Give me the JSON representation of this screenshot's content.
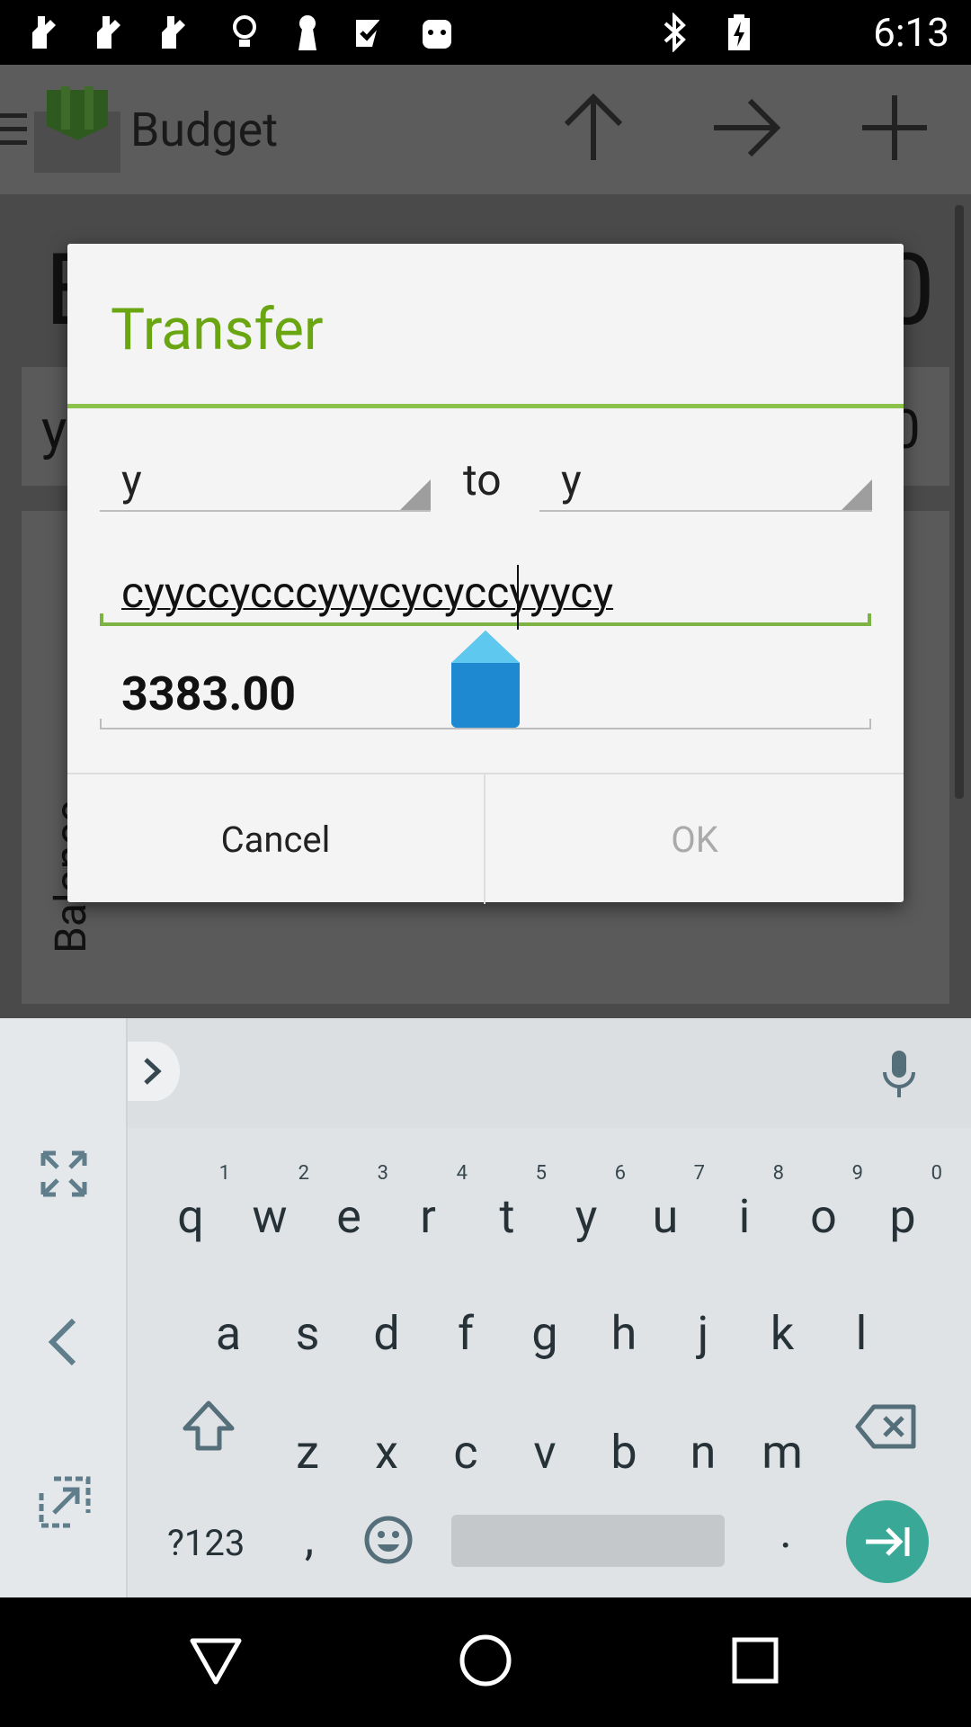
{
  "status_bar": {
    "time": "6:13",
    "icons": [
      "notification-icon",
      "notification-icon",
      "notification-icon",
      "lightbulb-icon",
      "keyhole-icon",
      "checkbox-icon",
      "android-icon",
      "bluetooth-icon",
      "battery-icon"
    ]
  },
  "app_bar": {
    "title": "Budget",
    "actions": [
      "arrow-up-icon",
      "arrow-right-icon",
      "plus-icon"
    ]
  },
  "background": {
    "big_left": "B",
    "big_right": "0",
    "row_left": "y",
    "row_right": "0",
    "vertical_label": "Balance"
  },
  "dialog": {
    "title": "Transfer",
    "from_account": "y",
    "to_label": "to",
    "to_account": "y",
    "description": "cyyccycccyyycycyccyyycy",
    "amount": "3383.00",
    "cancel_label": "Cancel",
    "ok_label": "OK"
  },
  "keyboard": {
    "row1": [
      {
        "key": "q",
        "hint": "1"
      },
      {
        "key": "w",
        "hint": "2"
      },
      {
        "key": "e",
        "hint": "3"
      },
      {
        "key": "r",
        "hint": "4"
      },
      {
        "key": "t",
        "hint": "5"
      },
      {
        "key": "y",
        "hint": "6"
      },
      {
        "key": "u",
        "hint": "7"
      },
      {
        "key": "i",
        "hint": "8"
      },
      {
        "key": "o",
        "hint": "9"
      },
      {
        "key": "p",
        "hint": "0"
      }
    ],
    "row2": [
      "a",
      "s",
      "d",
      "f",
      "g",
      "h",
      "j",
      "k",
      "l"
    ],
    "row3": [
      "z",
      "x",
      "c",
      "v",
      "b",
      "n",
      "m"
    ],
    "symbols_label": "?123",
    "comma": ",",
    "period": "."
  },
  "colors": {
    "accent_green": "#6aa612",
    "divider_green": "#8bc34a",
    "enter_teal": "#3aa896",
    "handle_blue": "#2196d3"
  }
}
